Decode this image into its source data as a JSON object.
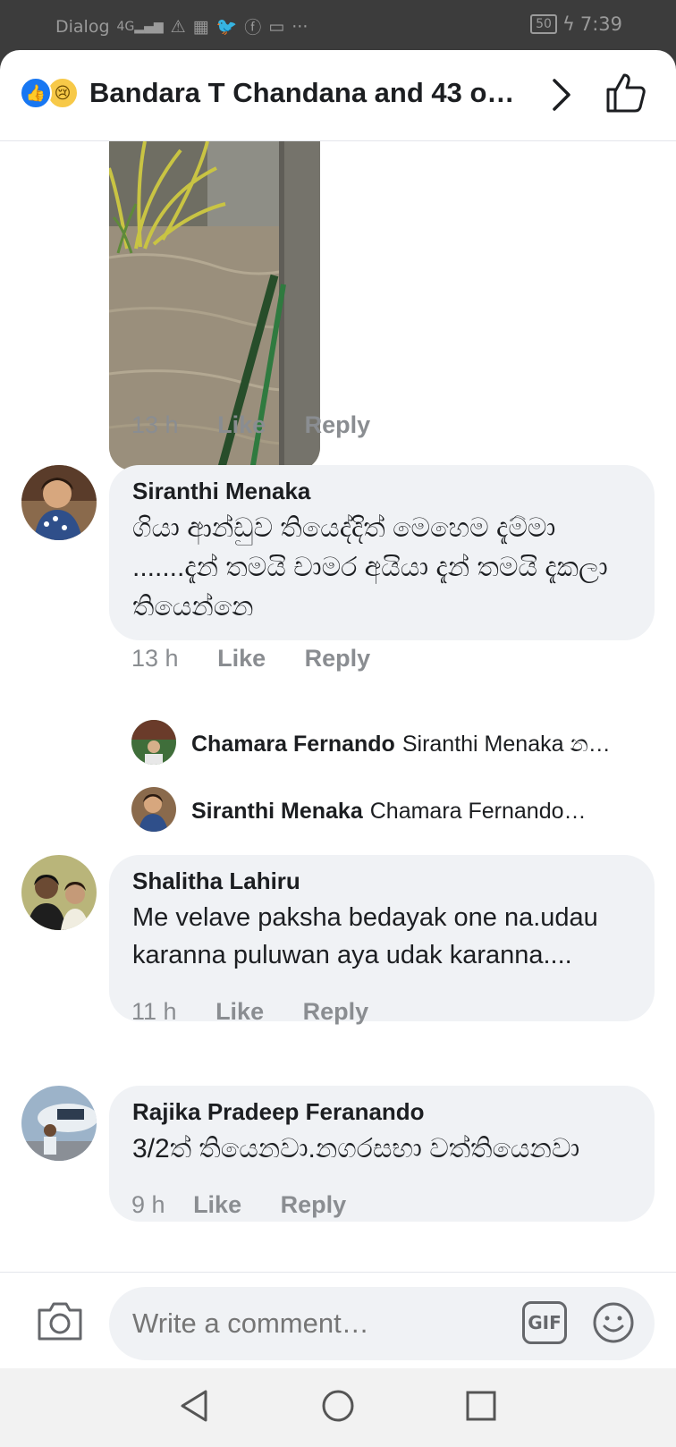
{
  "status_bar": {
    "carrier": "Dialog",
    "signal": "4G",
    "icons": [
      "warning-icon",
      "calendar-icon",
      "twitter-icon",
      "facebook-icon",
      "browser-icon",
      "more-icon"
    ],
    "battery": "50",
    "time": "7:39"
  },
  "header": {
    "reactions": [
      "like-reaction-icon",
      "sad-reaction-icon"
    ],
    "title": "Bandara T Chandana and 43 o…"
  },
  "comments": [
    {
      "author": "",
      "text": "",
      "time": "13 h",
      "like": "Like",
      "reply": "Reply"
    },
    {
      "author": "Siranthi Menaka",
      "text": "ගියා ආන්ඩුව තියෙද්දිත් මෙහෙම දැම්මා .......දැන් තමයි චාමර අයියා දැන් තමයි දැකලා තියෙන්නෙ",
      "time": "13 h",
      "like": "Like",
      "reply": "Reply",
      "replies": [
        {
          "author": "Chamara Fernando",
          "preview": "Siranthi Menaka න…"
        },
        {
          "author": "Siranthi Menaka",
          "preview": "Chamara Fernando…"
        }
      ]
    },
    {
      "author": "Shalitha Lahiru",
      "text": "Me velave paksha bedayak one na.udau karanna puluwan aya udak karanna....",
      "time": "11 h",
      "like": "Like",
      "reply": "Reply"
    },
    {
      "author": "Rajika Pradeep Feranando",
      "text": "3/2ත් තියෙනවා.නගරසභා වත්තියෙනවා",
      "time": "9 h",
      "like": "Like",
      "reply": "Reply"
    }
  ],
  "composer": {
    "placeholder": "Write a comment…",
    "gif_label": "GIF"
  },
  "colors": {
    "brand_blue": "#1877f2",
    "bubble_bg": "#f0f2f5",
    "meta_gray": "#8a8d91"
  }
}
